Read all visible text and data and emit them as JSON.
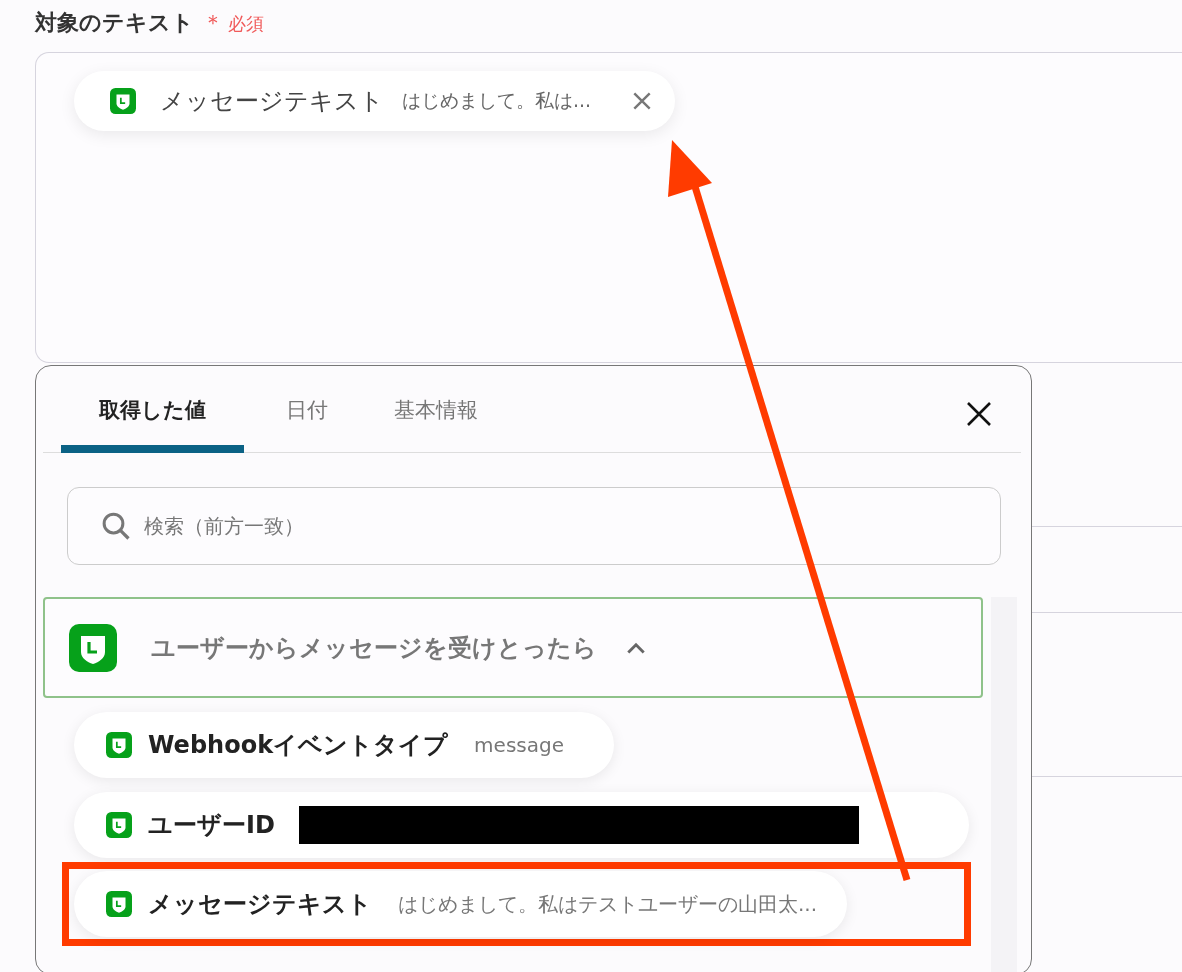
{
  "field": {
    "label": "対象のテキスト",
    "required_mark": "＊",
    "required_text": "必須",
    "chip": {
      "name": "メッセージテキスト",
      "value": "はじめまして。私は..."
    }
  },
  "picker": {
    "tabs": [
      {
        "label": "取得した値",
        "selected": true
      },
      {
        "label": "日付",
        "selected": false
      },
      {
        "label": "基本情報",
        "selected": false
      }
    ],
    "search": {
      "placeholder": "検索（前方一致）"
    },
    "group": {
      "title": "ユーザーからメッセージを受けとったら",
      "expanded": true
    },
    "items": [
      {
        "kind": "value",
        "name": "Webhookイベントタイプ",
        "value": "message",
        "highlighted": false
      },
      {
        "kind": "redacted",
        "name": "ユーザーID",
        "highlighted": false
      },
      {
        "kind": "value",
        "name": "メッセージテキスト",
        "value": "はじめまして。私はテストユーザーの山田太...",
        "highlighted": true
      }
    ]
  }
}
